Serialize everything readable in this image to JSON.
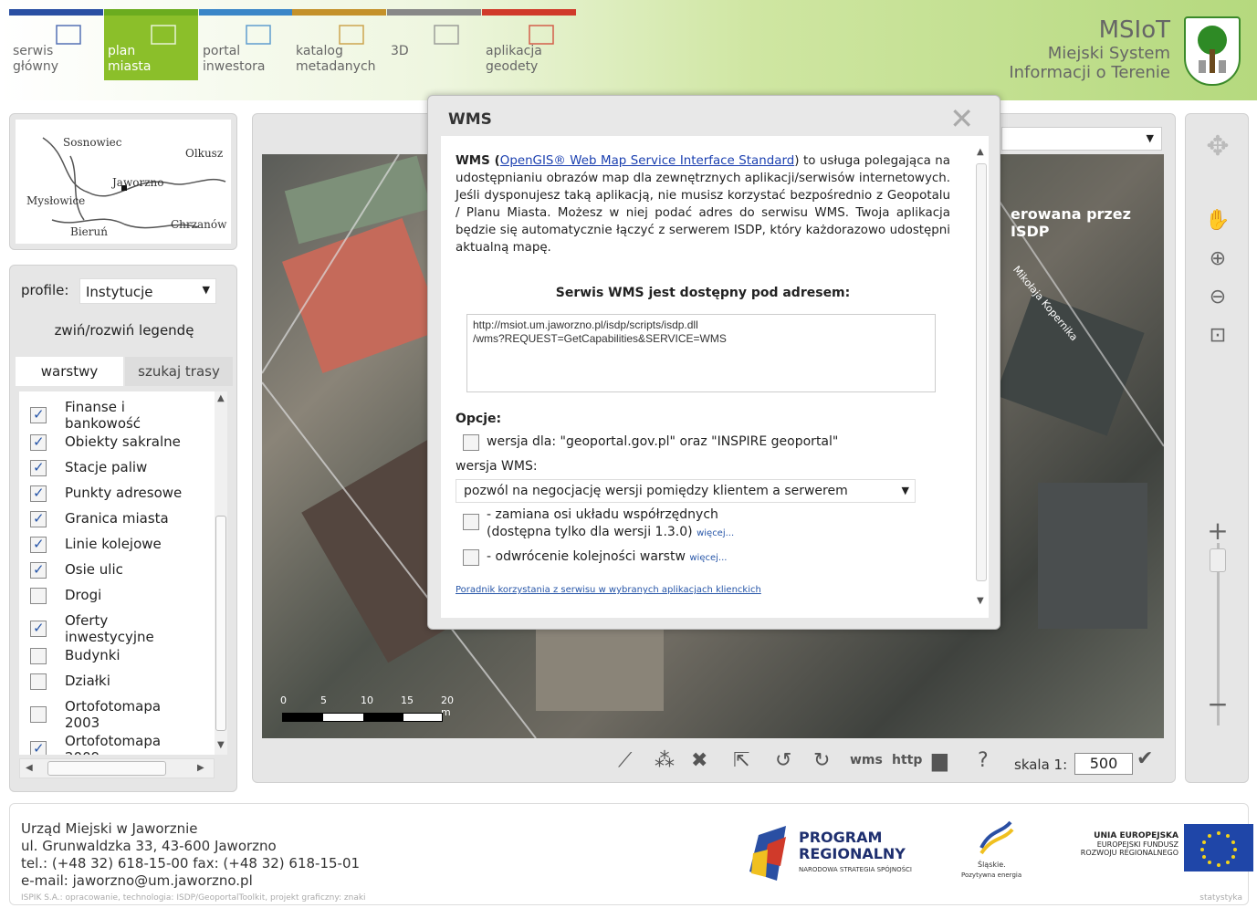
{
  "header": {
    "nav": [
      {
        "label": "serwis\ngłówny",
        "color": "#2a4fa3",
        "bg": "transparent",
        "text": "#666"
      },
      {
        "label": "plan\nmiasta",
        "color": "#6bac1f",
        "bg": "#8bbf2a",
        "text": "#fff"
      },
      {
        "label": "portal\ninwestora",
        "color": "#3a86c8",
        "bg": "transparent",
        "text": "#666"
      },
      {
        "label": "katalog\nmetadanych",
        "color": "#c4912a",
        "bg": "transparent",
        "text": "#666"
      },
      {
        "label": "3D",
        "color": "#888888",
        "bg": "transparent",
        "text": "#666"
      },
      {
        "label": "aplikacja\ngeodety",
        "color": "#d03a2a",
        "bg": "transparent",
        "text": "#666"
      }
    ],
    "brand_title": "MSIoT",
    "brand_line1": "Miejski System",
    "brand_line2": "Informacji o Terenie"
  },
  "minimap": {
    "towns": [
      "Sosnowiec",
      "Olkusz",
      "Jaworzno",
      "Mysłowice",
      "Bieruń",
      "Chrzanów"
    ]
  },
  "left_panel": {
    "profile_label": "profile:",
    "profile_value": "Instytucje",
    "toggle_legend": "zwiń/rozwiń legendę",
    "tab_layers": "warstwy",
    "tab_route": "szukaj trasy",
    "layers": [
      {
        "label": "Finanse i\nbankowość",
        "checked": true
      },
      {
        "label": "Obiekty sakralne",
        "checked": true
      },
      {
        "label": "Stacje paliw",
        "checked": true
      },
      {
        "label": "Punkty adresowe",
        "checked": true
      },
      {
        "label": "Granica miasta",
        "checked": true
      },
      {
        "label": "Linie kolejowe",
        "checked": true
      },
      {
        "label": "Osie ulic",
        "checked": true
      },
      {
        "label": "Drogi",
        "checked": false
      },
      {
        "label": "Oferty\ninwestycyjne",
        "checked": true
      },
      {
        "label": "Budynki",
        "checked": false
      },
      {
        "label": "Działki",
        "checked": false
      },
      {
        "label": "Ortofotomapa\n2003",
        "checked": false
      },
      {
        "label": "Ortofotomapa\n2009",
        "checked": true
      }
    ]
  },
  "map": {
    "overlay_label": "erowana przez ISDP",
    "street_label": "Mikołaja Kopernika",
    "scale_ticks": [
      "0",
      "5",
      "10",
      "15",
      "20 m"
    ],
    "scale_label": "skala 1:",
    "scale_value": "500",
    "wms_label": "wms",
    "http_label": "http"
  },
  "dialog": {
    "title": "WMS",
    "intro_prefix": "WMS (",
    "intro_link": "OpenGIS® Web Map Service Interface Standard",
    "intro_rest": ") to usługa polegająca na udostępnianiu obrazów map dla zewnętrznych aplikacji/serwisów internetowych. Jeśli dysponujesz taką aplikacją, nie musisz korzystać bezpośrednio z Geopotalu / Planu Miasta. Możesz w niej podać adres do serwisu WMS. Twoja aplikacja będzie się automatycznie łączyć z serwerem ISDP, który każdorazowo udostępni aktualną mapę.",
    "available_label": "Serwis WMS jest dostępny pod adresem:",
    "url": "http://msiot.um.jaworzno.pl/isdp/scripts/isdp.dll\n/wms?REQUEST=GetCapabilities&SERVICE=WMS",
    "options_label": "Opcje:",
    "opt_inspire": "wersja dla: \"geoportal.gov.pl\" oraz \"INSPIRE geoportal\"",
    "version_label": "wersja WMS:",
    "version_value": "pozwól na negocjację wersji pomiędzy klientem a serwerem",
    "opt_axis_line1": "- zamiana osi układu współrzędnych",
    "opt_axis_line2": "(dostępna tylko dla wersji 1.3.0)",
    "opt_order": "- odwrócenie kolejności warstw",
    "more": "więcej...",
    "guide_link": "Poradnik korzystania z serwisu w wybranych aplikacjach klienckich"
  },
  "footer": {
    "line1": "Urząd Miejski w Jaworznie",
    "line2": "ul. Grunwaldzka 33, 43-600 Jaworzno",
    "line3": "tel.: (+48 32) 618-15-00 fax: (+48 32) 618-15-01",
    "line4": "e-mail: jaworzno@um.jaworzno.pl",
    "credit": "ISPIK S.A.: opracowanie, technologia: ISDP/GeoportalToolkit, projekt graficzny: znaki",
    "stats": "statystyka",
    "logo1_line1": "PROGRAM",
    "logo1_line2": "REGIONALNY",
    "logo1_line3": "NARODOWA STRATEGIA SPÓJNOŚCI",
    "logo2_line1": "Śląskie.",
    "logo2_line2": "Pozytywna energia",
    "logo3_line1": "UNIA EUROPEJSKA",
    "logo3_line2": "EUROPEJSKI FUNDUSZ",
    "logo3_line3": "ROZWOJU REGIONALNEGO"
  }
}
